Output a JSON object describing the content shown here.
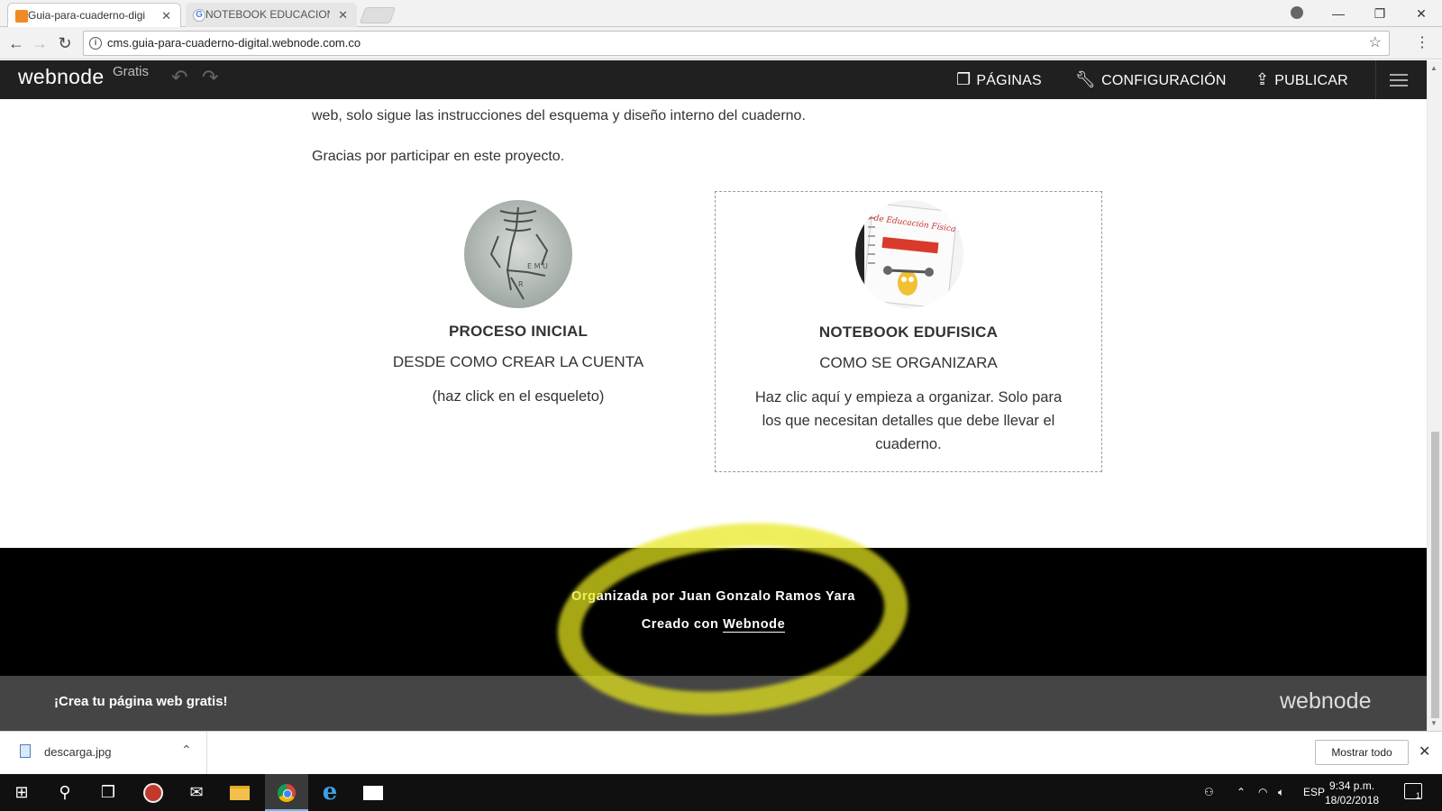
{
  "browser": {
    "tabs": [
      {
        "title": "Guia-para-cuaderno-digi",
        "active": true
      },
      {
        "title": "NOTEBOOK EDUCACION",
        "active": false
      }
    ],
    "url": "cms.guia-para-cuaderno-digital.webnode.com.co"
  },
  "editor": {
    "logo": "webnode",
    "plan": "Gratis",
    "menu": {
      "pages": "PÁGINAS",
      "settings": "CONFIGURACIÓN",
      "publish": "PUBLICAR"
    }
  },
  "page": {
    "intro_tail": "web, solo sigue las instrucciones del esquema y diseño interno del cuaderno.",
    "thanks": "Gracias por participar en este proyecto.",
    "cards": [
      {
        "title": "PROCESO INICIAL",
        "subtitle": "DESDE COMO CREAR LA CUENTA",
        "description": "(haz click en el esqueleto)"
      },
      {
        "title": "NOTEBOOK EDUFISICA",
        "subtitle": "COMO SE ORGANIZARA",
        "description": "Haz clic aquí y empieza a organizar. Solo para los que necesitan detalles que debe llevar el cuaderno.",
        "image_text": "El cuaderno de Educación Física de Pedro"
      }
    ]
  },
  "footer": {
    "organizer": "Organizada por Juan Gonzalo Ramos Yara",
    "created_prefix": "Creado con",
    "created_link": "Webnode"
  },
  "promo": {
    "text": "¡Crea tu página web gratis!",
    "logo": "webnode"
  },
  "downloads": {
    "file": "descarga.jpg",
    "show_all": "Mostrar todo"
  },
  "taskbar": {
    "lang": "ESP",
    "time": "9:34 p.m.",
    "date": "18/02/2018",
    "notifications": "1"
  },
  "colors": {
    "editor_bar": "#202020",
    "footer": "#000000",
    "promo": "#454545",
    "highlight": "#e8e81e"
  }
}
